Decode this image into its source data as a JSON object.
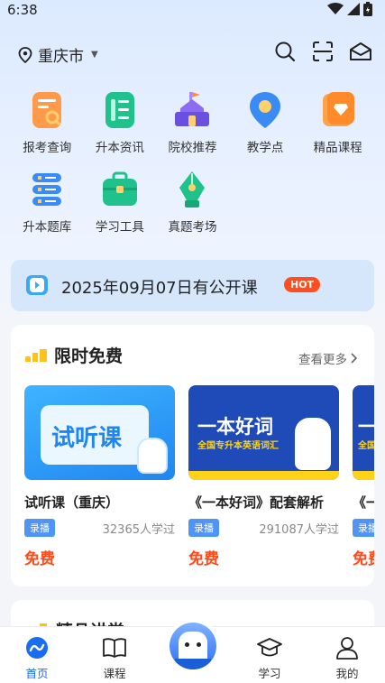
{
  "status": {
    "time": "6:38"
  },
  "location": {
    "city": "重庆市"
  },
  "grid": [
    {
      "label": "报考查询",
      "icon": "exam-search-icon"
    },
    {
      "label": "升本资讯",
      "icon": "news-icon"
    },
    {
      "label": "院校推荐",
      "icon": "school-icon"
    },
    {
      "label": "教学点",
      "icon": "location-pin-icon"
    },
    {
      "label": "精品课程",
      "icon": "premium-course-icon"
    },
    {
      "label": "升本题库",
      "icon": "question-bank-icon"
    },
    {
      "label": "学习工具",
      "icon": "toolbox-icon"
    },
    {
      "label": "真题考场",
      "icon": "pen-exam-icon"
    }
  ],
  "banner": {
    "text": "2025年09月07日有公开课",
    "badge": "HOT"
  },
  "free_section": {
    "title": "限时免费",
    "more": "查看更多",
    "courses": [
      {
        "title": "试听课（重庆）",
        "tag": "录播",
        "count": "32365人学过",
        "price": "免费",
        "thumb_text": "试听课"
      },
      {
        "title": "《一本好词》配套解析",
        "tag": "录播",
        "count": "291087人学过",
        "price": "免费",
        "thumb_text": "一本好词",
        "thumb_sub": "全国专升本英语词汇"
      },
      {
        "title": "《一",
        "tag": "录播",
        "count": "",
        "price": "免费",
        "thumb_text": "一",
        "thumb_sub": "全国"
      }
    ]
  },
  "next_section": {
    "title": "精品讲堂"
  },
  "tabbar": [
    {
      "label": "首页",
      "icon": "home-icon",
      "active": true
    },
    {
      "label": "课程",
      "icon": "book-icon",
      "active": false
    },
    {
      "label": "学习",
      "icon": "graduation-cap-icon",
      "active": false
    },
    {
      "label": "我的",
      "icon": "profile-icon",
      "active": false
    }
  ],
  "colors": {
    "accent": "#1a6cf0",
    "price": "#ff4a1a",
    "hot": "#ff4d1f",
    "tag": "#4f95f5"
  }
}
